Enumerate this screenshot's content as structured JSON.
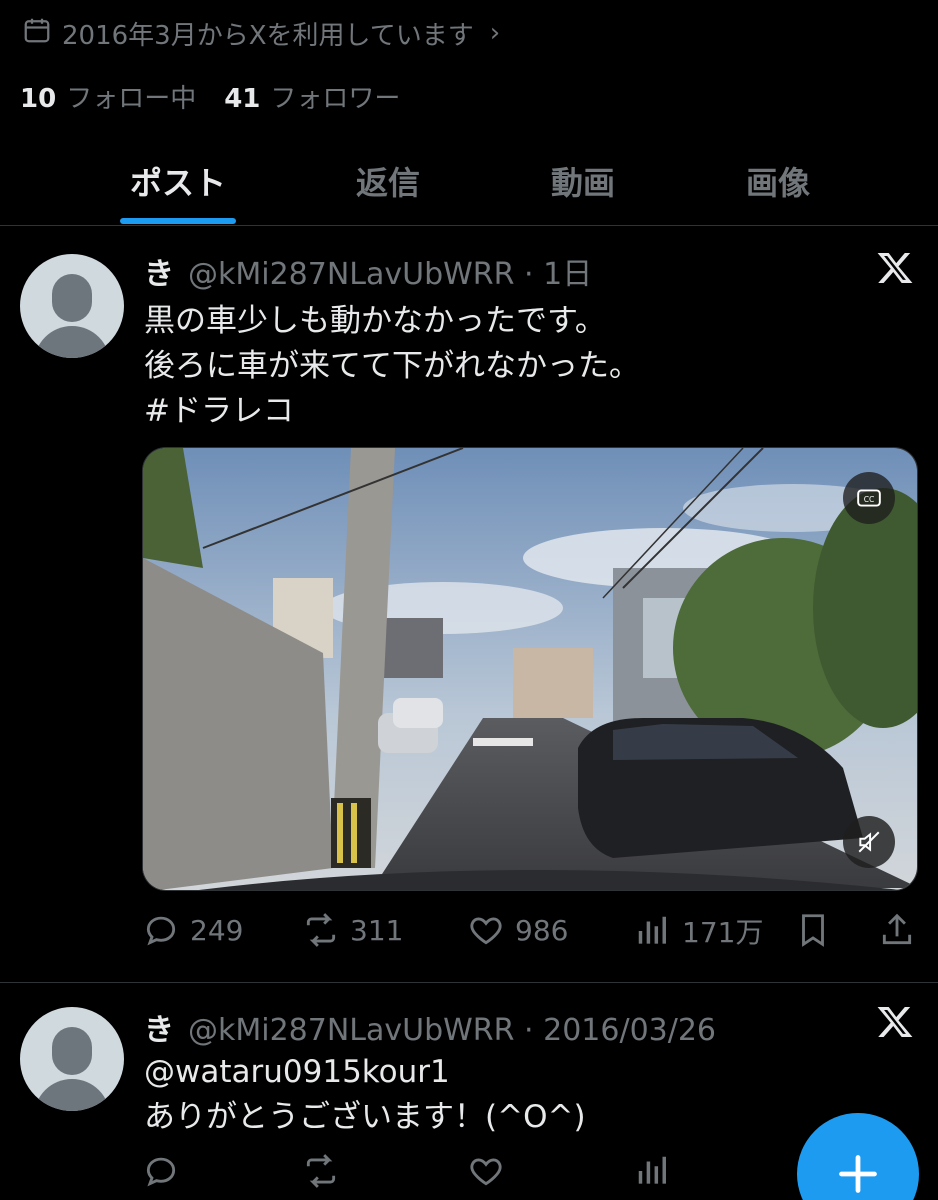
{
  "profile": {
    "joined_text": "2016年3月からXを利用しています",
    "following_count": "10",
    "following_label": "フォロー中",
    "followers_count": "41",
    "followers_label": "フォロワー"
  },
  "tabs": [
    {
      "label": "ポスト",
      "active": true
    },
    {
      "label": "返信",
      "active": false
    },
    {
      "label": "動画",
      "active": false
    },
    {
      "label": "画像",
      "active": false
    }
  ],
  "posts": [
    {
      "name": "き",
      "meta": "@kMi287NLavUbWRR · 1日",
      "lines": "黒の車少しも動かなかったです。\n後ろに車が来てて下がれなかった。\n#ドラレコ",
      "media": {
        "type": "video",
        "cc_icon": "closed-captions-icon",
        "mute_icon": "muted-speaker-icon"
      },
      "replies": "249",
      "reposts": "311",
      "likes": "986",
      "views": "171万"
    },
    {
      "name": "き",
      "meta": "@kMi287NLavUbWRR · 2016/03/26",
      "lines": "@wataru0915kour1\nありがとうございます！(^O^)"
    }
  ],
  "colors": {
    "accent": "#1d9bf0",
    "muted": "#71767b",
    "text": "#e7e9ea",
    "border": "#2f3336"
  }
}
